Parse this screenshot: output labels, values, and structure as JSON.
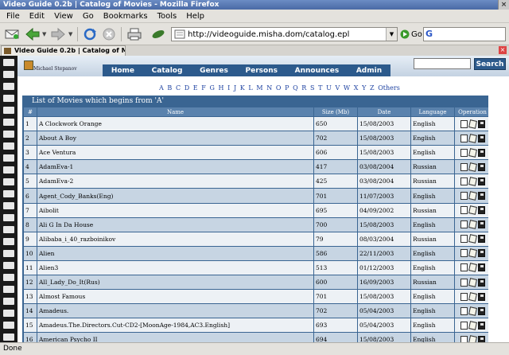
{
  "window": {
    "title": "Video Guide 0.2b | Catalog of Movies - Mozilla Firefox"
  },
  "menu": [
    "File",
    "Edit",
    "View",
    "Go",
    "Bookmarks",
    "Tools",
    "Help"
  ],
  "address": {
    "url": "http://videoguide.misha.dom/catalog.epl",
    "go_label": "Go"
  },
  "tab": {
    "label": "Video Guide 0.2b | Catalog of Mo..."
  },
  "site": {
    "logo_text": "Michael Stepanov",
    "nav": [
      "Home",
      "Catalog",
      "Genres",
      "Persons",
      "Announces",
      "Admin"
    ],
    "search_button": "Search"
  },
  "letters": [
    "A",
    "B",
    "C",
    "D",
    "E",
    "F",
    "G",
    "H",
    "I",
    "J",
    "K",
    "L",
    "M",
    "N",
    "O",
    "P",
    "Q",
    "R",
    "S",
    "T",
    "U",
    "V",
    "W",
    "X",
    "Y",
    "Z",
    "Others"
  ],
  "list": {
    "title": "List of Movies which begins from 'A'",
    "columns": [
      "#",
      "Name",
      "Size (Mb)",
      "Date",
      "Language",
      "Operation"
    ],
    "rows": [
      [
        "1",
        "A Clockwork Orange",
        "650",
        "15/08/2003",
        "English"
      ],
      [
        "2",
        "About A Boy",
        "702",
        "15/08/2003",
        "English"
      ],
      [
        "3",
        "Ace Ventura",
        "606",
        "15/08/2003",
        "English"
      ],
      [
        "4",
        "AdamEva-1",
        "417",
        "03/08/2004",
        "Russian"
      ],
      [
        "5",
        "AdamEva-2",
        "425",
        "03/08/2004",
        "Russian"
      ],
      [
        "6",
        "Agent_Cody_Banks(Eng)",
        "701",
        "11/07/2003",
        "English"
      ],
      [
        "7",
        "Aibolit",
        "695",
        "04/09/2002",
        "Russian"
      ],
      [
        "8",
        "Ali G In Da House",
        "700",
        "15/08/2003",
        "English"
      ],
      [
        "9",
        "Alibaba_i_40_razboinikov",
        "79",
        "08/03/2004",
        "Russian"
      ],
      [
        "10",
        "Alien",
        "586",
        "22/11/2003",
        "English"
      ],
      [
        "11",
        "Alien3",
        "513",
        "01/12/2003",
        "English"
      ],
      [
        "12",
        "All_Lady_Do_It(Rus)",
        "600",
        "16/09/2003",
        "Russian"
      ],
      [
        "13",
        "Almost Famous",
        "701",
        "15/08/2003",
        "English"
      ],
      [
        "14",
        "Amadeus.",
        "702",
        "05/04/2003",
        "English"
      ],
      [
        "15",
        "Amadeus.The.Directors.Cut-CD2-[MoonAge-1984,AC3.English]",
        "693",
        "05/04/2003",
        "English"
      ],
      [
        "16",
        "American Psycho II",
        "694",
        "15/08/2003",
        "English"
      ]
    ]
  },
  "status": {
    "text": "Done"
  }
}
